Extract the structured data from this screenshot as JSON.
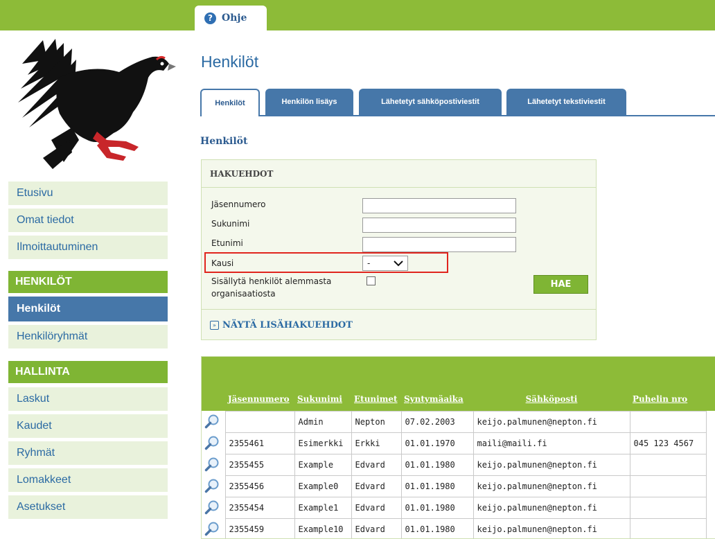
{
  "top_tab": {
    "label": "Ohje",
    "icon": "help-icon"
  },
  "sidebar": {
    "items_top": [
      {
        "label": "Etusivu"
      },
      {
        "label": "Omat tiedot"
      },
      {
        "label": "Ilmoittautuminen"
      }
    ],
    "section_henkilot": {
      "title": "HENKILÖT",
      "items": [
        {
          "label": "Henkilöt",
          "active": true
        },
        {
          "label": "Henkilöryhmät"
        }
      ]
    },
    "section_hallinta": {
      "title": "HALLINTA",
      "items": [
        {
          "label": "Laskut"
        },
        {
          "label": "Kaudet"
        },
        {
          "label": "Ryhmät"
        },
        {
          "label": "Lomakkeet"
        },
        {
          "label": "Asetukset"
        }
      ]
    }
  },
  "main": {
    "page_title": "Henkilöt",
    "tabs": [
      {
        "label": "Henkilöt",
        "active": true
      },
      {
        "label": "Henkilön lisäys"
      },
      {
        "label": "Lähetetyt sähköpostiviestit"
      },
      {
        "label": "Lähetetyt tekstiviestit"
      }
    ],
    "section_title": "Henkilöt",
    "search": {
      "header": "HAKUEHDOT",
      "fields": [
        {
          "label": "Jäsennumero",
          "value": ""
        },
        {
          "label": "Sukunimi",
          "value": ""
        },
        {
          "label": "Etunimi",
          "value": ""
        }
      ],
      "season_label": "Kausi",
      "season_value": "-",
      "include_sub_label_1": "Sisällytä henkilöt alemmasta",
      "include_sub_label_2": "organisaatiosta",
      "include_sub_checked": false,
      "search_button": "HAE",
      "more_filters": "NÄYTÄ LISÄHAKUEHDOT"
    },
    "results": {
      "columns": [
        "Jäsennumero",
        "Sukunimi",
        "Etunimet",
        "Syntymäaika",
        "Sähköposti",
        "Puhelin nro"
      ],
      "rows": [
        [
          "",
          "Admin",
          "Nepton",
          "07.02.2003",
          "keijo.palmunen@nepton.fi",
          ""
        ],
        [
          "2355461",
          "Esimerkki",
          "Erkki",
          "01.01.1970",
          "maili@maili.fi",
          "045 123 4567"
        ],
        [
          "2355455",
          "Example",
          "Edvard",
          "01.01.1980",
          "keijo.palmunen@nepton.fi",
          ""
        ],
        [
          "2355456",
          "Example0",
          "Edvard",
          "01.01.1980",
          "keijo.palmunen@nepton.fi",
          ""
        ],
        [
          "2355454",
          "Example1",
          "Edvard",
          "01.01.1980",
          "keijo.palmunen@nepton.fi",
          ""
        ],
        [
          "2355459",
          "Example10",
          "Edvard",
          "01.01.1980",
          "keijo.palmunen@nepton.fi",
          ""
        ]
      ]
    }
  },
  "colors": {
    "brand_green": "#8dbb38",
    "nav_blue": "#4677a9",
    "link_blue": "#2b6aa3",
    "highlight_red": "#e0241d"
  }
}
